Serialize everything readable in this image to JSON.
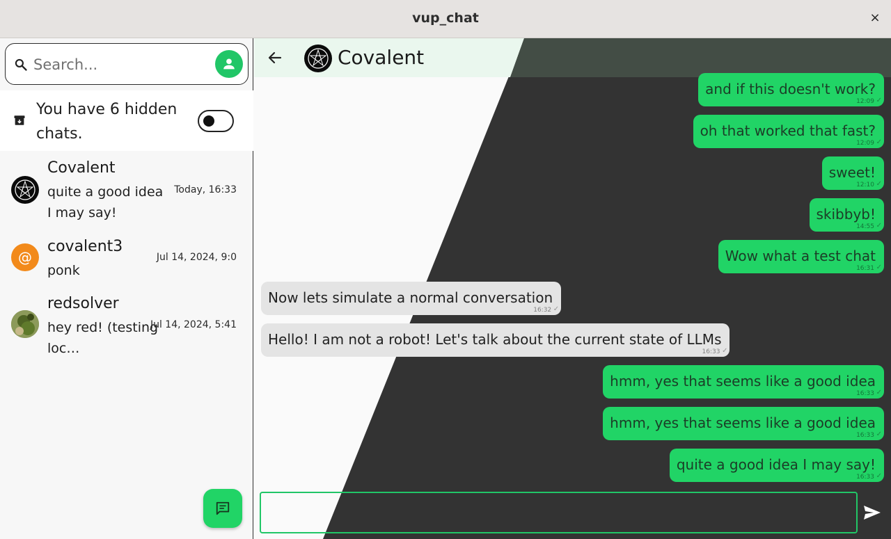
{
  "window": {
    "title": "vup_chat",
    "close_label": "×"
  },
  "sidebar": {
    "search": {
      "placeholder": "Search...",
      "value": ""
    },
    "hidden_chats": {
      "text": "You have 6 hidden chats.",
      "toggle_on": false
    },
    "chats": [
      {
        "name": "Covalent",
        "preview": "quite a good idea I may say!",
        "time": "Today, 16:33",
        "avatar": "pentagram-logo"
      },
      {
        "name": "covalent3",
        "preview": "ponk",
        "time": "Jul 14, 2024, 9:0",
        "avatar": "at-sign",
        "avatar_color": "#f28a1b"
      },
      {
        "name": "redsolver",
        "preview": "hey red! (testing loc…",
        "time": "Jul 14, 2024, 5:41",
        "avatar": "photo"
      }
    ]
  },
  "chat": {
    "contact_name": "Covalent",
    "messages": [
      {
        "text": "and if this doesn't work?",
        "time": "12:09",
        "direction": "out"
      },
      {
        "text": "oh that worked that fast?",
        "time": "12:09",
        "direction": "out"
      },
      {
        "text": "sweet!",
        "time": "12:10",
        "direction": "out"
      },
      {
        "text": "skibbyb!",
        "time": "14:55",
        "direction": "out"
      },
      {
        "text": "Wow what a test chat",
        "time": "16:31",
        "direction": "out"
      },
      {
        "text": "Now lets simulate a normal conversation",
        "time": "16:32",
        "direction": "in"
      },
      {
        "text": "Hello! I am not a robot! Let's talk about the current state of LLMs",
        "time": "16:33",
        "direction": "in"
      },
      {
        "text": "hmm, yes that seems like a good idea",
        "time": "16:33",
        "direction": "out"
      },
      {
        "text": "hmm, yes that seems like a good idea",
        "time": "16:33",
        "direction": "out"
      },
      {
        "text": "quite a good idea I may say!",
        "time": "16:33",
        "direction": "out"
      }
    ],
    "composer": {
      "value": "",
      "placeholder": ""
    }
  },
  "colors": {
    "accent_green": "#21d466",
    "header_tint": "#eaf7ee",
    "dark_background": "#333333",
    "incoming_bubble": "#e4e4e4"
  }
}
